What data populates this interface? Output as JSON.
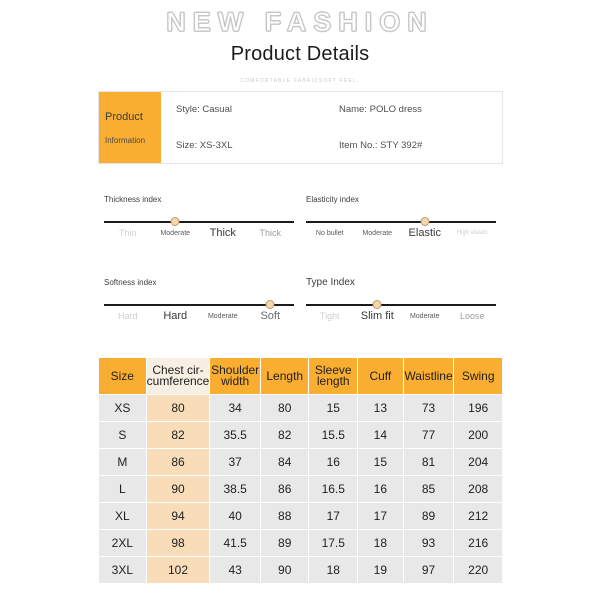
{
  "header": {
    "banner": "NEW FASHION",
    "title": "Product Details",
    "subtitle": "COMFORTABLE FABRICSOFT FEEL."
  },
  "product_info": {
    "label_line1": "Product",
    "label_line2": "Information",
    "style_label": "Style: Casual",
    "name_label": "Name: POLO dress",
    "size_label": "Size: XS-3XL",
    "item_label": "Item No.: STY 392#"
  },
  "indices": [
    {
      "title": "Thickness index",
      "levels": [
        "Thin",
        "Moderate",
        "Thick",
        "Thick"
      ],
      "selected": 1
    },
    {
      "title": "Elasticity index",
      "levels": [
        "No bullet",
        "Moderate",
        "Elastic",
        "High elastic"
      ],
      "selected": 2
    },
    {
      "title": "Softness index",
      "levels": [
        "Hard",
        "Hard",
        "Moderate",
        "Soft"
      ],
      "selected": 3
    },
    {
      "title": "Type Index",
      "levels": [
        "Tight",
        "Slim fit",
        "Moderate",
        "Loose"
      ],
      "selected": 1
    }
  ],
  "size_table": {
    "headers": [
      "Size",
      "Chest cir-cumference",
      "Shoulder width",
      "Length",
      "Sleeve length",
      "Cuff",
      "Waistline",
      "Swing"
    ],
    "rows": [
      {
        "size": "XS",
        "chest": "80",
        "shoulder": "34",
        "length": "80",
        "sleeve": "15",
        "cuff": "13",
        "waistline": "73",
        "swing": "196"
      },
      {
        "size": "S",
        "chest": "82",
        "shoulder": "35.5",
        "length": "82",
        "sleeve": "15.5",
        "cuff": "14",
        "waistline": "77",
        "swing": "200"
      },
      {
        "size": "M",
        "chest": "86",
        "shoulder": "37",
        "length": "84",
        "sleeve": "16",
        "cuff": "15",
        "waistline": "81",
        "swing": "204"
      },
      {
        "size": "L",
        "chest": "90",
        "shoulder": "38.5",
        "length": "86",
        "sleeve": "16.5",
        "cuff": "16",
        "waistline": "85",
        "swing": "208"
      },
      {
        "size": "XL",
        "chest": "94",
        "shoulder": "40",
        "length": "88",
        "sleeve": "17",
        "cuff": "17",
        "waistline": "89",
        "swing": "212"
      },
      {
        "size": "2XL",
        "chest": "98",
        "shoulder": "41.5",
        "length": "89",
        "sleeve": "17.5",
        "cuff": "18",
        "waistline": "93",
        "swing": "216"
      },
      {
        "size": "3XL",
        "chest": "102",
        "shoulder": "43",
        "length": "90",
        "sleeve": "18",
        "cuff": "19",
        "waistline": "97",
        "swing": "220"
      }
    ]
  },
  "colors": {
    "accent_orange": "#f9ad31",
    "cell_gray": "#e8e8e8",
    "chest_highlight": "#f8ddb8",
    "dot": "#f6d6ab"
  }
}
